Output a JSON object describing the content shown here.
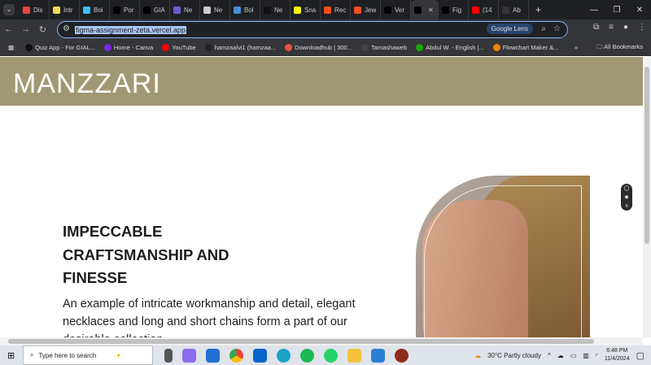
{
  "browser": {
    "tabs": [
      {
        "label": "Dis",
        "color": "#e8453c"
      },
      {
        "label": "Intr",
        "color": "#f0db4f"
      },
      {
        "label": "Boi",
        "color": "#38bdf8"
      },
      {
        "label": "Por",
        "color": "#000000"
      },
      {
        "label": "GIA",
        "color": "#000000"
      },
      {
        "label": "Ne",
        "color": "#6b5bd6"
      },
      {
        "label": "Ne",
        "color": "#cccccc"
      },
      {
        "label": "Bol",
        "color": "#4a90d9"
      },
      {
        "label": "Ne",
        "color": "#111111"
      },
      {
        "label": "Sna",
        "color": "#fffc00"
      },
      {
        "label": "Rec",
        "color": "#f24e1e"
      },
      {
        "label": "Jew",
        "color": "#f24e1e"
      },
      {
        "label": "Ver",
        "color": "#000000"
      },
      {
        "label": "",
        "color": "#000000"
      },
      {
        "label": "Fig",
        "color": "#000000"
      },
      {
        "label": "(14",
        "color": "#ff0000"
      },
      {
        "label": "Ab",
        "color": "#333333"
      }
    ],
    "url": "figma-assignment-zeta.vercel.app",
    "lens_label": "Google Lens",
    "bookmarks": [
      {
        "label": "Quiz App - For GIAL...",
        "color": "#111"
      },
      {
        "label": "Home - Canva",
        "color": "#7d2ae8"
      },
      {
        "label": "YouTube",
        "color": "#ff0000"
      },
      {
        "label": "hamzaalvi1 (hamzaa...",
        "color": "#222"
      },
      {
        "label": "Downloadhub | 300...",
        "color": "#e8553c"
      },
      {
        "label": "Tamashaweb",
        "color": "#444"
      },
      {
        "label": "Abdul W. - English |...",
        "color": "#14a800"
      },
      {
        "label": "Flowchart Maker &...",
        "color": "#f08705"
      }
    ],
    "all_bookmarks": "All Bookmarks"
  },
  "page": {
    "logo": "MANZZARI",
    "heading": "IMPECCABLE CRAFTSMANSHIP AND FINESSE",
    "paragraph": "An example of intricate workmanship and detail, elegant necklaces and long and short chains form a part of our desirable collection.",
    "header_color": "#a19873"
  },
  "taskbar": {
    "search_placeholder": "Type here to search",
    "weather": "30°C  Partly cloudy",
    "time": "6:48 PM",
    "date": "11/4/2024"
  }
}
